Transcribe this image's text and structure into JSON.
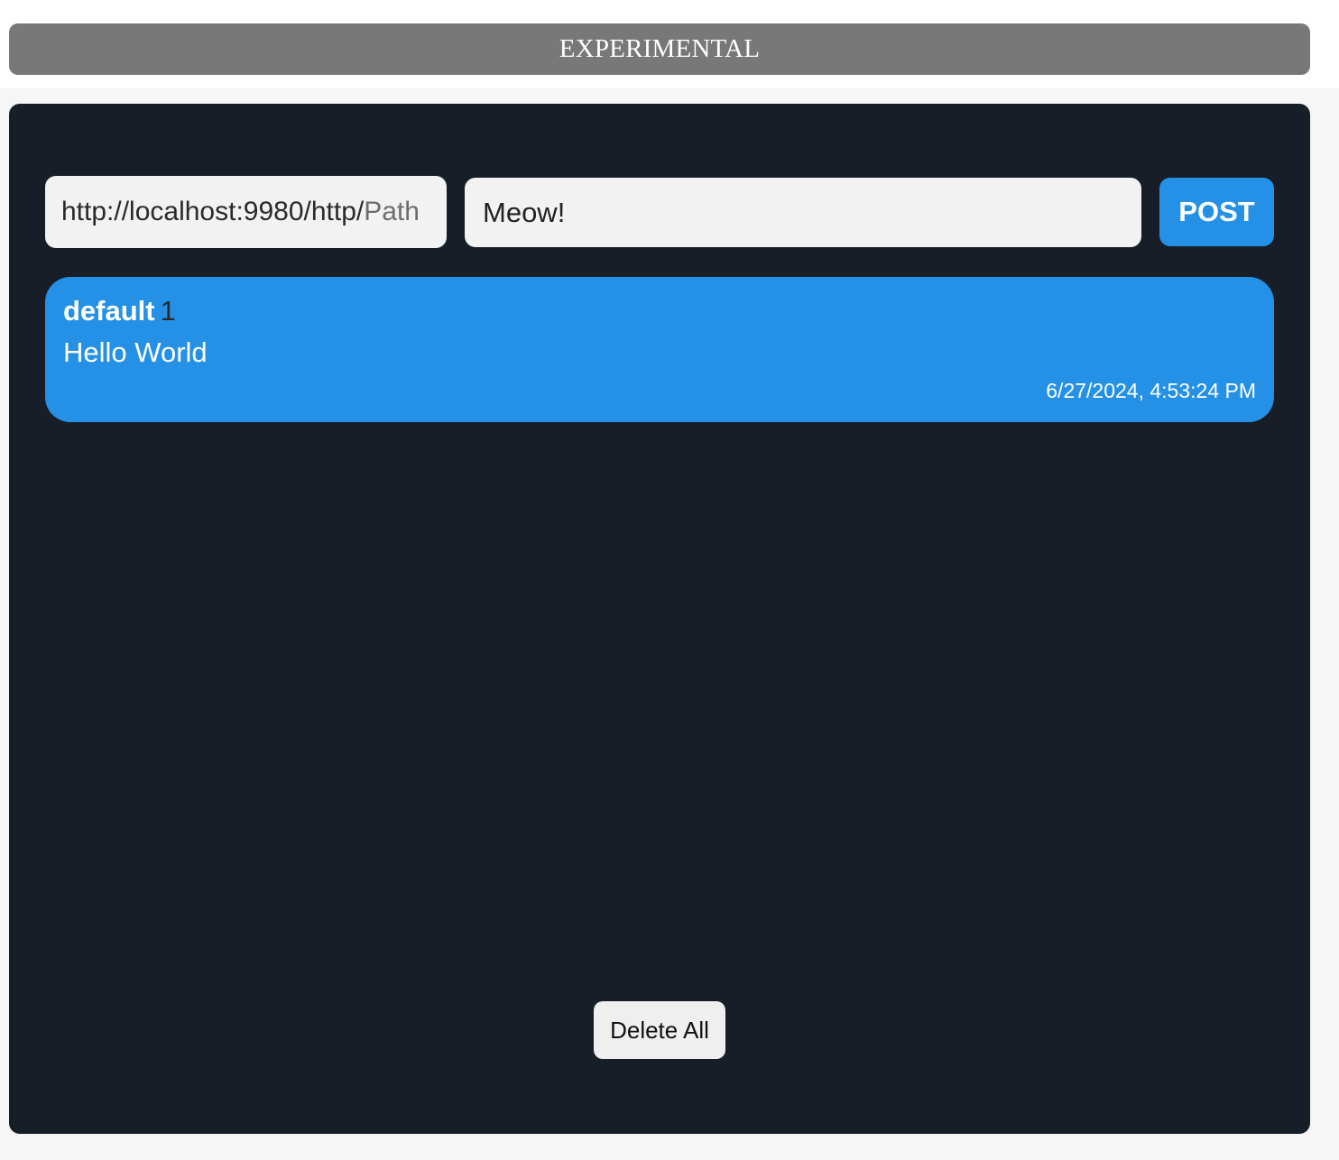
{
  "banner": {
    "label": "EXPERIMENTAL"
  },
  "form": {
    "path_prefix": "http://localhost:9980/http/",
    "path_placeholder": "Path",
    "message_value": "Meow!",
    "post_label": "POST"
  },
  "messages": [
    {
      "author": "default",
      "count": "1",
      "text": "Hello World",
      "timestamp": "6/27/2024, 4:53:24 PM"
    }
  ],
  "footer": {
    "delete_all_label": "Delete All"
  },
  "colors": {
    "banner_bg": "#787878",
    "panel_bg": "#171e27",
    "accent": "#2591e6",
    "input_bg": "#f2f2f2"
  }
}
